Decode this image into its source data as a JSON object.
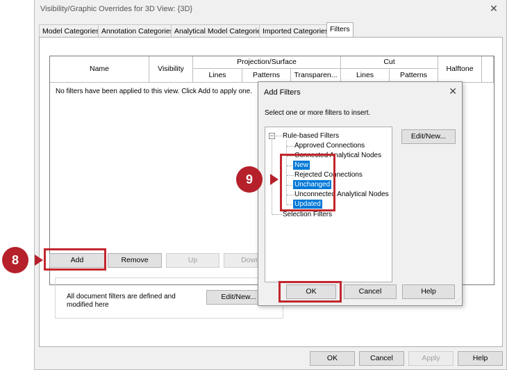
{
  "main_dialog": {
    "title": "Visibility/Graphic Overrides for 3D View: {3D}",
    "tabs": [
      {
        "label": "Model Categories"
      },
      {
        "label": "Annotation Categories"
      },
      {
        "label": "Analytical Model Categories"
      },
      {
        "label": "Imported Categories"
      },
      {
        "label": "Filters"
      }
    ],
    "active_tab": "Filters",
    "grid": {
      "headers": {
        "name": "Name",
        "visibility": "Visibility",
        "projection_surface": "Projection/Surface",
        "cut": "Cut",
        "halftone": "Halftone",
        "lines": "Lines",
        "patterns": "Patterns",
        "transparency": "Transparen...",
        "cut_lines": "Lines",
        "cut_patterns": "Patterns"
      },
      "empty_message": "No filters have been applied to this view. Click Add to apply one."
    },
    "buttons": {
      "add": "Add",
      "remove": "Remove",
      "up": "Up",
      "down": "Down",
      "edit_new": "Edit/New...",
      "ok": "OK",
      "cancel": "Cancel",
      "apply": "Apply",
      "help": "Help"
    },
    "doc_filters_text": "All document filters are defined and modified here"
  },
  "add_filters_dialog": {
    "title": "Add Filters",
    "prompt": "Select one or more filters to insert.",
    "tree": {
      "group_rule": "Rule-based Filters",
      "items": [
        {
          "label": "Approved Connections",
          "selected": false
        },
        {
          "label": "Connected Analytical Nodes",
          "selected": false
        },
        {
          "label": "New",
          "selected": true
        },
        {
          "label": "Rejected Connections",
          "selected": false
        },
        {
          "label": "Unchanged",
          "selected": true
        },
        {
          "label": "Unconnected Analytical Nodes",
          "selected": false
        },
        {
          "label": "Updated",
          "selected": true
        }
      ],
      "group_selection": "Selection Filters"
    },
    "buttons": {
      "edit_new": "Edit/New...",
      "ok": "OK",
      "cancel": "Cancel",
      "help": "Help"
    }
  },
  "callouts": {
    "step_8": "8",
    "step_9": "9"
  },
  "colors": {
    "highlight": "#c1272d",
    "marker": "#b5202a",
    "selection": "#0078d7"
  }
}
